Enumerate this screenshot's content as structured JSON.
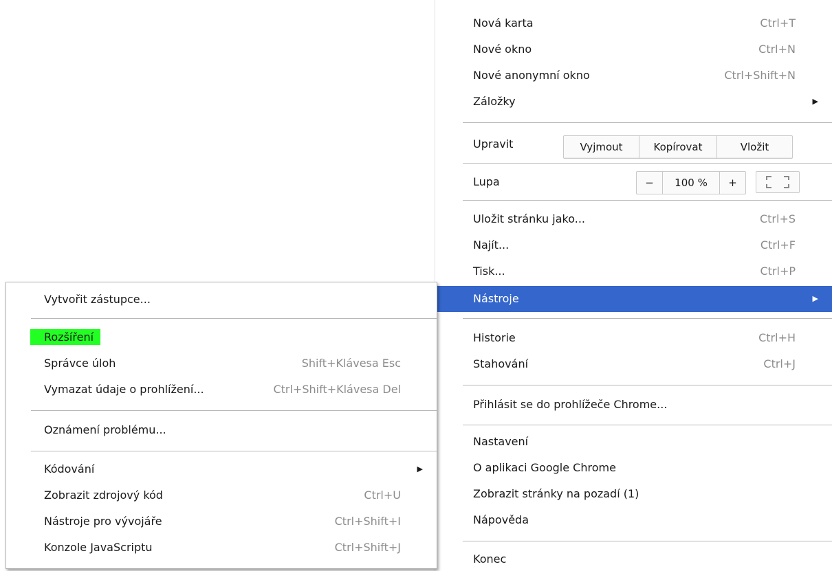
{
  "main_menu": {
    "items": [
      {
        "label": "Nová karta",
        "shortcut": "Ctrl+T"
      },
      {
        "label": "Nové okno",
        "shortcut": "Ctrl+N"
      },
      {
        "label": "Nové anonymní okno",
        "shortcut": "Ctrl+Shift+N"
      },
      {
        "label": "Záložky",
        "shortcut": ""
      }
    ],
    "edit": {
      "label": "Upravit",
      "cut": "Vyjmout",
      "copy": "Kopírovat",
      "paste": "Vložit"
    },
    "zoom": {
      "label": "Lupa",
      "minus": "−",
      "value": "100 %",
      "plus": "+"
    },
    "items2": [
      {
        "label": "Uložit stránku jako...",
        "shortcut": "Ctrl+S"
      },
      {
        "label": "Najít...",
        "shortcut": "Ctrl+F"
      },
      {
        "label": "Tisk...",
        "shortcut": "Ctrl+P"
      },
      {
        "label": "Nástroje",
        "shortcut": ""
      }
    ],
    "items3": [
      {
        "label": "Historie",
        "shortcut": "Ctrl+H"
      },
      {
        "label": "Stahování",
        "shortcut": "Ctrl+J"
      }
    ],
    "signin": "Přihlásit se do prohlížeče Chrome...",
    "items4": [
      {
        "label": "Nastavení"
      },
      {
        "label": "O aplikaci Google Chrome"
      },
      {
        "label": "Zobrazit stránky na pozadí (1)"
      },
      {
        "label": "Nápověda"
      }
    ],
    "exit": "Konec"
  },
  "sub_menu": {
    "items": [
      {
        "label": "Vytvořit zástupce...",
        "shortcut": ""
      },
      {
        "label": "Rozšíření",
        "shortcut": ""
      },
      {
        "label": "Správce úloh",
        "shortcut": "Shift+Klávesa Esc"
      },
      {
        "label": "Vymazat údaje o prohlížení...",
        "shortcut": "Ctrl+Shift+Klávesa Del"
      },
      {
        "label": "Oznámení problému...",
        "shortcut": ""
      },
      {
        "label": "Kódování",
        "shortcut": ""
      },
      {
        "label": "Zobrazit zdrojový kód",
        "shortcut": "Ctrl+U"
      },
      {
        "label": "Nástroje pro vývojáře",
        "shortcut": "Ctrl+Shift+I"
      },
      {
        "label": "Konzole JavaScriptu",
        "shortcut": "Ctrl+Shift+J"
      }
    ]
  },
  "colors": {
    "highlight": "#3466cc",
    "marker": "#22ff22",
    "shortcut_text": "#8c8c8c"
  },
  "icons": {
    "submenu_arrow": "triangle-right-icon",
    "fullscreen": "fullscreen-icon"
  }
}
